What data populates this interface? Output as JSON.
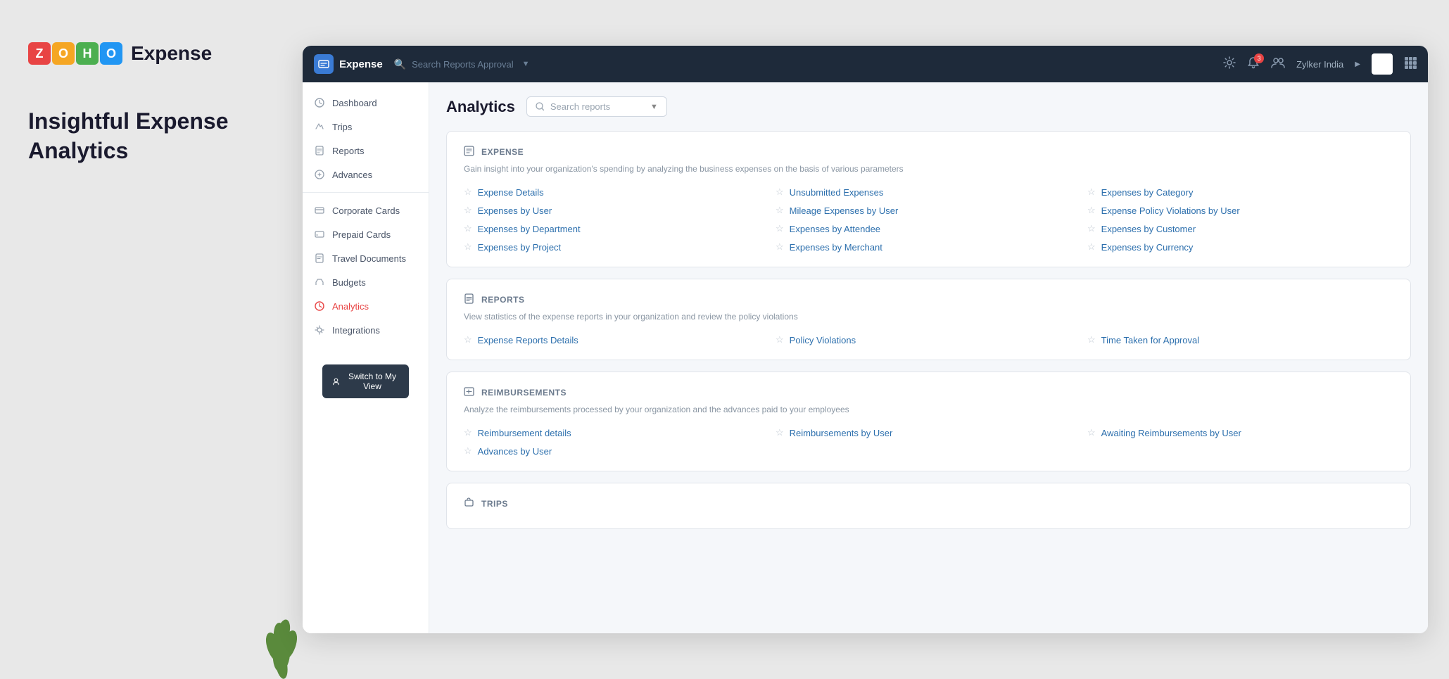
{
  "left_panel": {
    "logo": {
      "letters": [
        "Z",
        "O",
        "H",
        "O"
      ],
      "colors": [
        "#e84444",
        "#f5a623",
        "#4caf50",
        "#2196f3"
      ],
      "product": "Expense"
    },
    "tagline": "Insightful Expense Analytics"
  },
  "top_nav": {
    "logo_label": "Expense",
    "search_placeholder": "Search Reports Approval",
    "org_name": "Zylker India",
    "notification_count": "3"
  },
  "sidebar": {
    "items": [
      {
        "id": "dashboard",
        "label": "Dashboard",
        "icon": "⏱"
      },
      {
        "id": "trips",
        "label": "Trips",
        "icon": "✈"
      },
      {
        "id": "reports",
        "label": "Reports",
        "icon": "📁"
      },
      {
        "id": "advances",
        "label": "Advances",
        "icon": "⏱"
      },
      {
        "id": "corporate-cards",
        "label": "Corporate Cards",
        "icon": "💳"
      },
      {
        "id": "prepaid-cards",
        "label": "Prepaid Cards",
        "icon": "🪪"
      },
      {
        "id": "travel-documents",
        "label": "Travel Documents",
        "icon": "📋"
      },
      {
        "id": "budgets",
        "label": "Budgets",
        "icon": "📊"
      },
      {
        "id": "analytics",
        "label": "Analytics",
        "icon": "⏱",
        "active": true
      },
      {
        "id": "integrations",
        "label": "Integrations",
        "icon": "⚙"
      }
    ],
    "switch_btn_label": "Switch to My View"
  },
  "content": {
    "title": "Analytics",
    "search_placeholder": "Search reports",
    "sections": [
      {
        "id": "expense",
        "icon": "▣",
        "title": "EXPENSE",
        "description": "Gain insight into your organization's spending by analyzing the business expenses on the basis of various parameters",
        "links": [
          "Expense Details",
          "Unsubmitted Expenses",
          "Expenses by Category",
          "Expenses by User",
          "Mileage Expenses by User",
          "Expense Policy Violations by User",
          "Expenses by Department",
          "Expenses by Attendee",
          "Expenses by Customer",
          "Expenses by Project",
          "Expenses by Merchant",
          "Expenses by Currency"
        ]
      },
      {
        "id": "reports",
        "icon": "📁",
        "title": "REPORTS",
        "description": "View statistics of the expense reports in your organization and review the policy violations",
        "links": [
          "Expense Reports Details",
          "Policy Violations",
          "Time Taken for Approval"
        ]
      },
      {
        "id": "reimbursements",
        "icon": "▣",
        "title": "REIMBURSEMENTS",
        "description": "Analyze the reimbursements processed by your organization and the advances paid to your employees",
        "links": [
          "Reimbursement details",
          "Reimbursements by User",
          "Awaiting Reimbursements by User",
          "Advances by User"
        ]
      },
      {
        "id": "trips",
        "icon": "📁",
        "title": "TRIPS",
        "description": "",
        "links": []
      }
    ]
  }
}
